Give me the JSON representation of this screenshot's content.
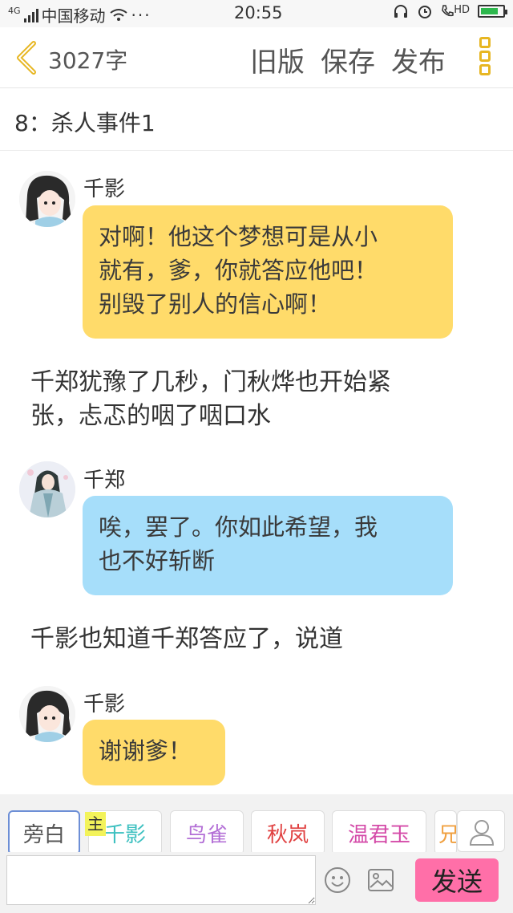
{
  "status_bar": {
    "carrier": "中国移动",
    "network": "4G",
    "time": "20:55",
    "hd_label": "HD"
  },
  "header": {
    "word_count": "3027字",
    "old_version": "旧版",
    "save": "保存",
    "publish": "发布"
  },
  "chapter_title": "8：杀人事件1",
  "messages": [
    {
      "type": "dialogue",
      "speaker": "千影",
      "text_lines": [
        "对啊！他这个梦想可是从小",
        "就有，爹，你就答应他吧！",
        "别毁了别人的信心啊！"
      ],
      "bubble_color": "#ffdb6a"
    },
    {
      "type": "narration",
      "text_lines": [
        "千郑犹豫了几秒，门秋烨也开始紧",
        "张，忐忑的咽了咽口水"
      ]
    },
    {
      "type": "dialogue",
      "speaker": "千郑",
      "text_lines": [
        "唉，罢了。你如此希望，我",
        "也不好斩断"
      ],
      "bubble_color": "#a6defa"
    },
    {
      "type": "narration",
      "text_lines": [
        "千影也知道千郑答应了，说道"
      ]
    },
    {
      "type": "dialogue",
      "speaker": "千影",
      "text_lines": [
        "谢谢爹！"
      ],
      "bubble_color": "#ffdb6a"
    }
  ],
  "roles": [
    {
      "label": "旁白",
      "color": "#555555"
    },
    {
      "label": "千影",
      "color": "#3cc0c0"
    },
    {
      "label": "鸟雀",
      "color": "#b36fd6"
    },
    {
      "label": "秋岚",
      "color": "#e04040"
    },
    {
      "label": "温君玉",
      "color": "#d44aa8"
    },
    {
      "label": "兄",
      "color": "#f0a040"
    }
  ],
  "main_tag": "主",
  "input": {
    "value": "",
    "placeholder": ""
  },
  "send_label": "发送",
  "icons": [
    "back-chevron-icon",
    "menu-icon",
    "profile-icon",
    "emoji-icon",
    "image-icon",
    "wifi-icon",
    "battery-icon"
  ]
}
